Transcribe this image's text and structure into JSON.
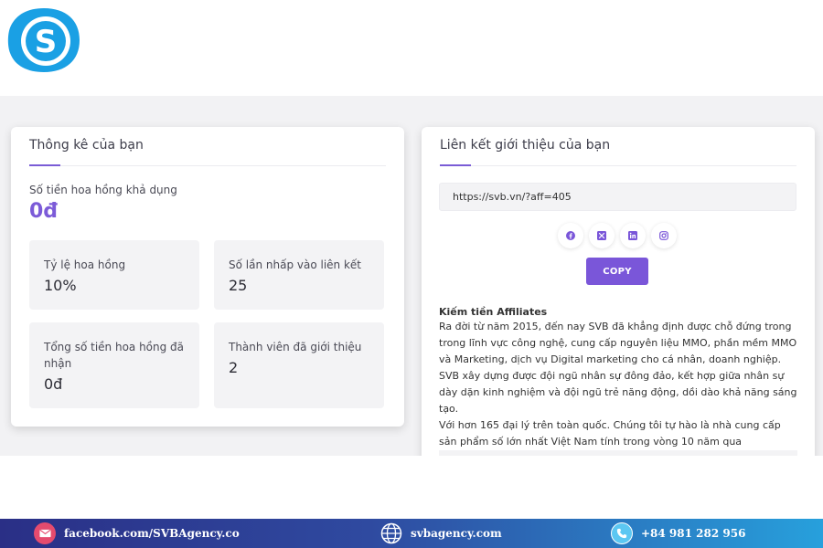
{
  "brand": {
    "logo_letter": "S",
    "logo_color": "#1aa0e4"
  },
  "stats_card": {
    "title": "Thông kê của bạn",
    "available_label": "Số tiền hoa hồng khả dụng",
    "available_value": "0đ",
    "items": [
      {
        "label": "Tỷ lệ hoa hồng",
        "value": "10%"
      },
      {
        "label": "Số lần nhấp vào liên kết",
        "value": "25"
      },
      {
        "label": "Tổng số tiền hoa hồng đã nhận",
        "value": "0đ"
      },
      {
        "label": "Thành viên đã giới thiệu",
        "value": "2"
      }
    ]
  },
  "referral_card": {
    "title": "Liên kết giới thiệu của bạn",
    "link_value": "https://svb.vn/?aff=405",
    "share_icons": [
      "facebook-icon",
      "x-icon",
      "linkedin-icon",
      "instagram-icon"
    ],
    "copy_label": "COPY",
    "affiliate_title": "Kiếm tiền Affiliates",
    "affiliate_paragraph_1": "Ra đời từ năm 2015, đến nay SVB đã khẳng định được chỗ đứng trong trong lĩnh vực công nghệ, cung cấp nguyên liệu MMO, phần mềm MMO và Marketing, dịch vụ Digital marketing cho cá nhân, doanh nghiệp. SVB xây dựng được đội ngũ nhân sự đông đảo, kết hợp giữa nhân sự dày dặn kinh nghiệm và đội ngũ trẻ năng động, dồi dào khả năng sáng tạo.",
    "affiliate_paragraph_2": "Với hơn 165 đại lý trên toàn quốc. Chúng tôi tự hào là nhà cung cấp sản phẩm số lớn nhất Việt Nam tính trong vòng 10 năm qua"
  },
  "footer": {
    "facebook": "facebook.com/SVBAgency.co",
    "website": "svbagency.com",
    "phone": "+84 981 282 956"
  },
  "colors": {
    "accent": "#7a56d9",
    "page_bg": "#f2f2f4",
    "footer_start": "#2a2f86",
    "footer_end": "#27a0dc"
  }
}
